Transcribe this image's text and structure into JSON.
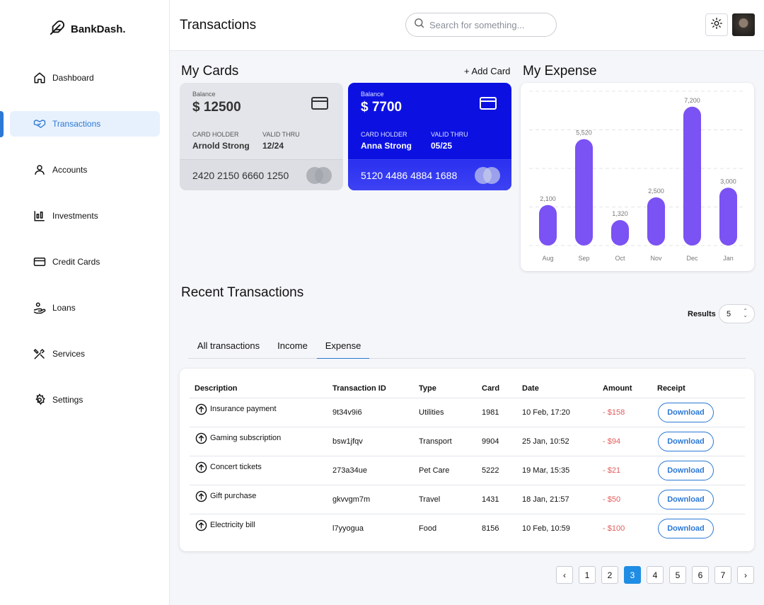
{
  "brand": {
    "name": "BankDash."
  },
  "nav": {
    "items": [
      {
        "label": "Dashboard",
        "icon": "home-icon"
      },
      {
        "label": "Transactions",
        "icon": "handshake-icon",
        "active": true
      },
      {
        "label": "Accounts",
        "icon": "user-icon"
      },
      {
        "label": "Investments",
        "icon": "investment-icon"
      },
      {
        "label": "Credit Cards",
        "icon": "credit-card-icon"
      },
      {
        "label": "Loans",
        "icon": "loan-icon"
      },
      {
        "label": "Services",
        "icon": "tools-icon"
      },
      {
        "label": "Settings",
        "icon": "gear-icon"
      }
    ]
  },
  "header": {
    "title": "Transactions",
    "search_placeholder": "Search for something..."
  },
  "cards_section": {
    "title": "My Cards",
    "add_label": "+ Add Card",
    "cards": [
      {
        "balance_label": "Balance",
        "balance": "$ 12500",
        "holder_label": "CARD HOLDER",
        "holder": "Arnold Strong",
        "valid_label": "VALID THRU",
        "valid": "12/24",
        "number": "2420 2150 6660 1250"
      },
      {
        "balance_label": "Balance",
        "balance": "$ 7700",
        "holder_label": "CARD HOLDER",
        "holder": "Anna Strong",
        "valid_label": "VALID THRU",
        "valid": "05/25",
        "number": "5120 4486 4884 1688"
      }
    ]
  },
  "expense_section": {
    "title": "My Expense"
  },
  "chart_data": {
    "type": "bar",
    "categories": [
      "Aug",
      "Sep",
      "Oct",
      "Nov",
      "Dec",
      "Jan"
    ],
    "values": [
      2100,
      5520,
      1320,
      2500,
      7200,
      3000
    ],
    "value_labels": [
      "2,100",
      "5,520",
      "1,320",
      "2,500",
      "7,200",
      "3,000"
    ],
    "ylim": [
      0,
      8000
    ],
    "grid": true,
    "bar_color": "#7b52f3"
  },
  "transactions": {
    "title": "Recent Transactions",
    "results_label": "Results",
    "results_value": "5",
    "tabs": [
      "All transactions",
      "Income",
      "Expense"
    ],
    "active_tab": "Expense",
    "columns": [
      "Description",
      "Transaction ID",
      "Type",
      "Card",
      "Date",
      "Amount",
      "Receipt"
    ],
    "rows": [
      {
        "description": "Insurance payment",
        "id": "9t34v9i6",
        "type": "Utilities",
        "card": "1981",
        "date": "10 Feb, 17:20",
        "amount": "- $158",
        "receipt": "Download"
      },
      {
        "description": "Gaming subscription",
        "id": "bsw1jfqv",
        "type": "Transport",
        "card": "9904",
        "date": "25 Jan, 10:52",
        "amount": "- $94",
        "receipt": "Download"
      },
      {
        "description": "Concert tickets",
        "id": "273a34ue",
        "type": "Pet Care",
        "card": "5222",
        "date": "19 Mar, 15:35",
        "amount": "- $21",
        "receipt": "Download"
      },
      {
        "description": "Gift purchase",
        "id": "gkvvgm7m",
        "type": "Travel",
        "card": "1431",
        "date": "18 Jan, 21:57",
        "amount": "- $50",
        "receipt": "Download"
      },
      {
        "description": "Electricity bill",
        "id": "l7yyogua",
        "type": "Food",
        "card": "8156",
        "date": "10 Feb, 10:59",
        "amount": "- $100",
        "receipt": "Download"
      }
    ]
  },
  "pagination": {
    "pages": [
      "1",
      "2",
      "3",
      "4",
      "5",
      "6",
      "7"
    ],
    "current": "3",
    "prev": "‹",
    "next": "›"
  },
  "colors": {
    "accent": "#2b78d5",
    "card_blue": "#0c11e2",
    "expense_red": "#e35b5b",
    "chart_purple": "#7b52f3"
  }
}
